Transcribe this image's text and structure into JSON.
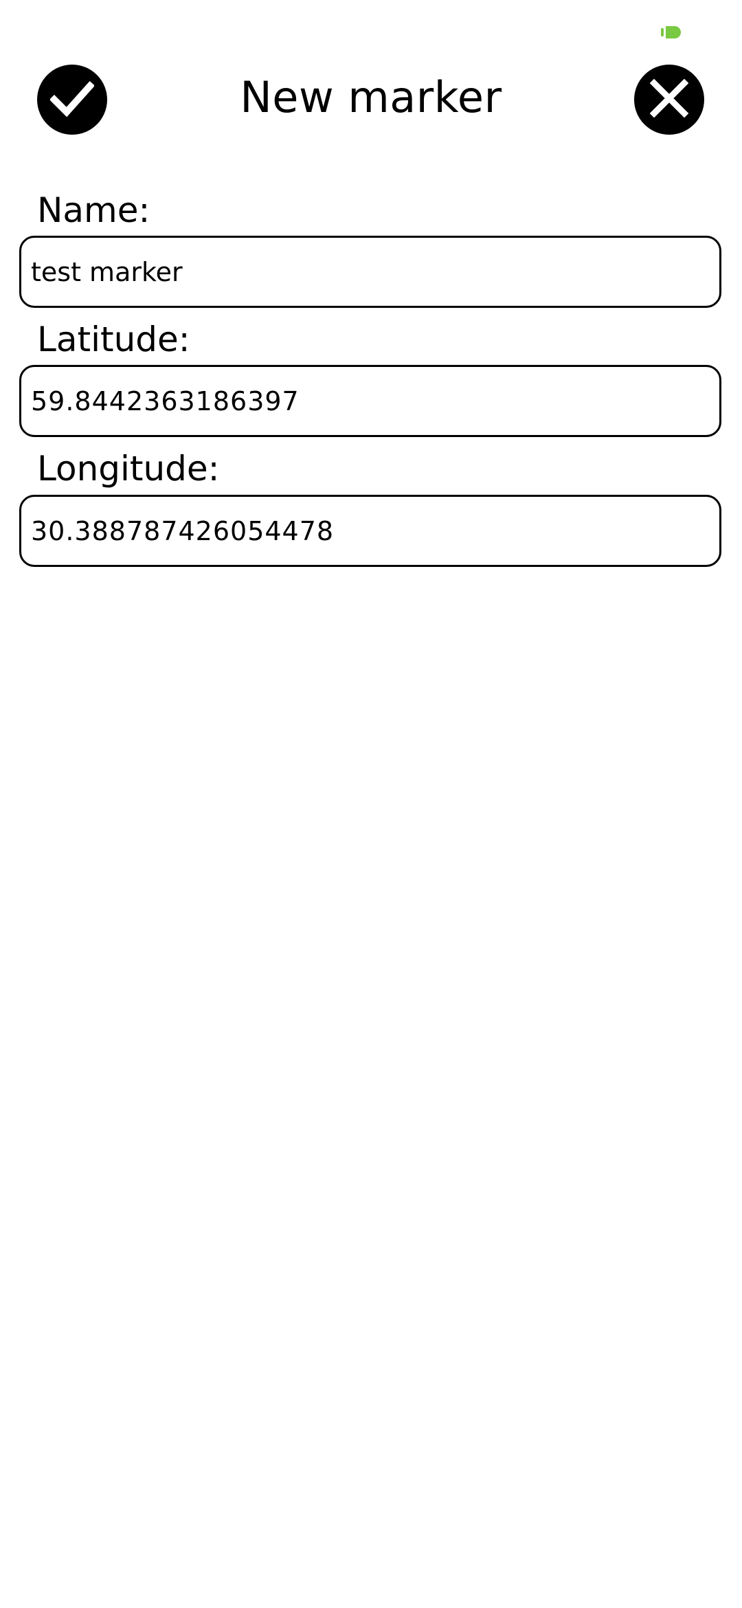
{
  "status_bar": {
    "indicator_icon": "battery-icon",
    "indicator_color": "#7ac943"
  },
  "header": {
    "title": "New marker",
    "confirm_icon": "check-icon",
    "close_icon": "close-icon"
  },
  "form": {
    "name_label": "Name:",
    "name_value": "test marker",
    "latitude_label": "Latitude:",
    "latitude_value": "59.8442363186397",
    "longitude_label": "Longitude:",
    "longitude_value": "30.388787426054478"
  },
  "colors": {
    "background": "#ffffff",
    "foreground": "#000000"
  }
}
